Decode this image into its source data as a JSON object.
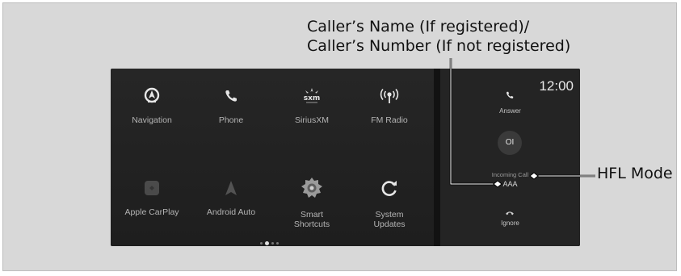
{
  "callouts": {
    "caller_name": "Caller’s Name (If registered)/",
    "caller_number": "Caller’s Number (If not registered)",
    "hfl_mode": "HFL Mode"
  },
  "home": {
    "apps": [
      {
        "label": "Navigation",
        "icon": "navigation-icon"
      },
      {
        "label": "Phone",
        "icon": "phone-icon"
      },
      {
        "label": "SiriusXM",
        "icon": "siriusxm-icon",
        "icon_text": "sxm"
      },
      {
        "label": "FM Radio",
        "icon": "fm-radio-icon"
      },
      {
        "label": "Apple CarPlay",
        "icon": "apple-carplay-icon"
      },
      {
        "label": "Android Auto",
        "icon": "android-auto-icon"
      },
      {
        "label": "Smart",
        "label_line2": "Shortcuts",
        "icon": "smart-shortcuts-icon"
      },
      {
        "label": "System",
        "label_line2": "Updates",
        "icon": "system-updates-icon"
      }
    ],
    "page_count": 4,
    "active_page": 2
  },
  "call_panel": {
    "time": "12:00",
    "answer_label": "Answer",
    "avatar_initials": "OI",
    "incoming_label": "Incoming Call",
    "caller": "AAA",
    "ignore_label": "Ignore"
  },
  "colors": {
    "background": "#d8d8d8",
    "screen": "#1c1c1c",
    "leader_line": "#000000"
  }
}
